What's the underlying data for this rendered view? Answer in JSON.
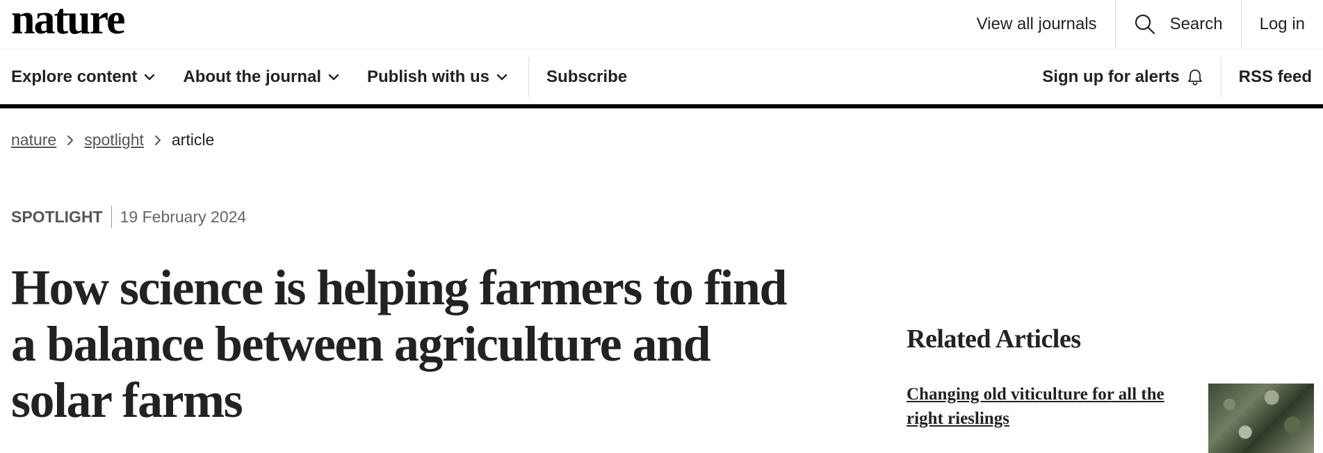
{
  "header": {
    "logo": "nature",
    "links": {
      "view_all_journals": "View all journals",
      "search": "Search",
      "log_in": "Log in"
    }
  },
  "nav": {
    "explore_content": "Explore content",
    "about_the_journal": "About the journal",
    "publish_with_us": "Publish with us",
    "subscribe": "Subscribe",
    "sign_up_for_alerts": "Sign up for alerts",
    "rss_feed": "RSS feed"
  },
  "breadcrumb": {
    "items": [
      "nature",
      "spotlight",
      "article"
    ]
  },
  "article": {
    "type": "SPOTLIGHT",
    "date": "19 February 2024",
    "title": "How science is helping farmers to find a balance between agriculture and solar farms"
  },
  "related": {
    "heading": "Related Articles",
    "items": [
      {
        "title": "Changing old viticulture for all the right rieslings"
      }
    ]
  },
  "colors": {
    "text": "#222222",
    "muted": "#666666",
    "nav_rule": "#000000"
  },
  "icons": [
    "search-icon",
    "chevron-down-icon",
    "bell-icon",
    "chevron-right-icon"
  ]
}
